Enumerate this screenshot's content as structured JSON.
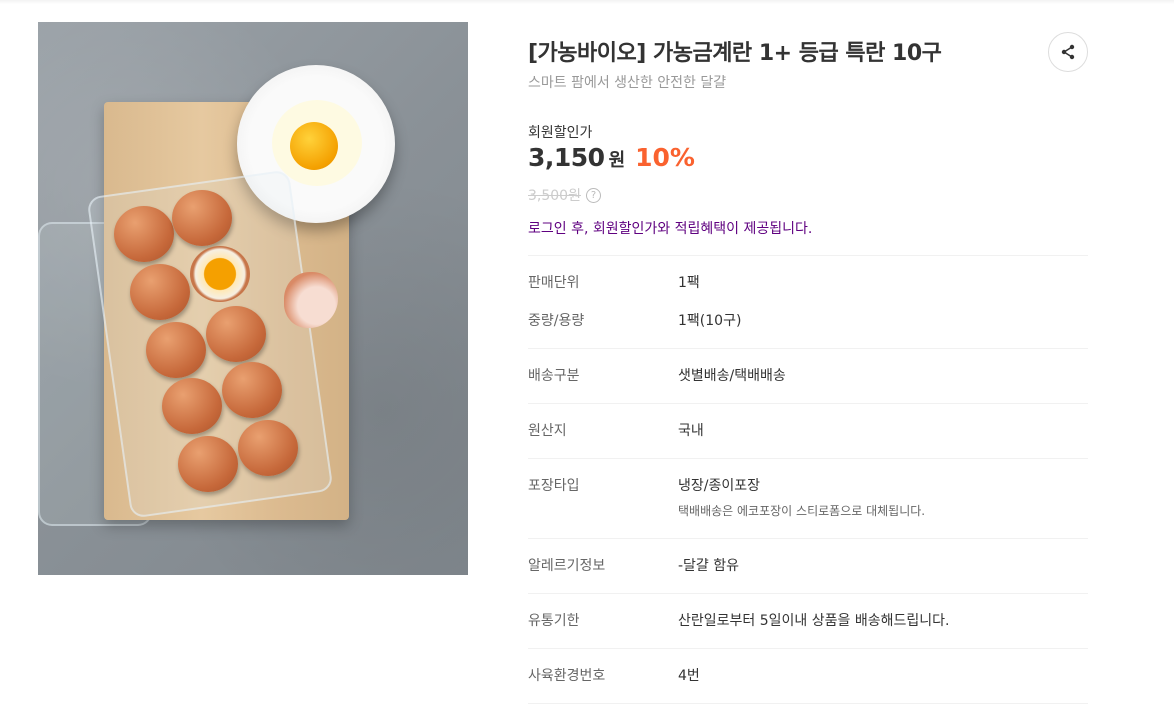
{
  "product": {
    "title": "[가농바이오] 가농금계란 1+ 등급 특란 10구",
    "subtitle": "스마트 팜에서 생산한 안전한 달걀",
    "share_icon": "share-icon"
  },
  "price": {
    "label": "회원할인가",
    "value": "3,150",
    "unit": "원",
    "discount": "10%",
    "original": "3,500원",
    "help_icon": "help-circle-icon",
    "login_notice": "로그인 후, 회원할인가와 적립혜택이 제공됩니다."
  },
  "details": [
    {
      "label": "판매단위",
      "value": "1팩"
    },
    {
      "label": "중량/용량",
      "value": "1팩(10구)"
    },
    {
      "label": "배송구분",
      "value": "샛별배송/택배배송"
    },
    {
      "label": "원산지",
      "value": "국내"
    },
    {
      "label": "포장타입",
      "value": "냉장/종이포장",
      "sub": "택배배송은 에코포장이 스티로폼으로 대체됩니다."
    },
    {
      "label": "알레르기정보",
      "value": "-달걀 함유"
    },
    {
      "label": "유통기한",
      "value": "산란일로부터 5일이내 상품을 배송해드립니다."
    },
    {
      "label": "사육환경번호",
      "value": "4번"
    }
  ],
  "colors": {
    "accent": "#5f0080",
    "discount": "#fa622f",
    "title": "#333333"
  }
}
